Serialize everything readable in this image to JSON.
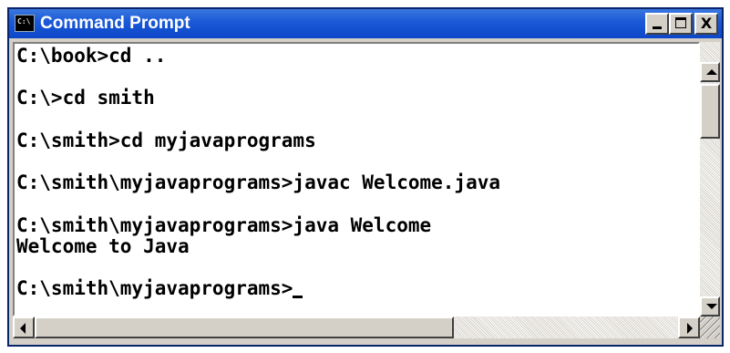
{
  "window": {
    "title": "Command Prompt",
    "icon": "console-icon",
    "icon_text": "C:\\"
  },
  "controls": {
    "minimize": "minimize-icon",
    "maximize": "maximize-icon",
    "close_label": "X"
  },
  "console": {
    "lines": [
      "C:\\book>cd ..",
      "",
      "C:\\>cd smith",
      "",
      "C:\\smith>cd myjavaprograms",
      "",
      "C:\\smith\\myjavaprograms>javac Welcome.java",
      "",
      "C:\\smith\\myjavaprograms>java Welcome",
      "Welcome to Java",
      "",
      "C:\\smith\\myjavaprograms>"
    ]
  },
  "colors": {
    "titlebar": "#0b47c8",
    "console_bg": "#ffffff",
    "console_fg": "#000000",
    "chrome": "#d4d0c8"
  }
}
